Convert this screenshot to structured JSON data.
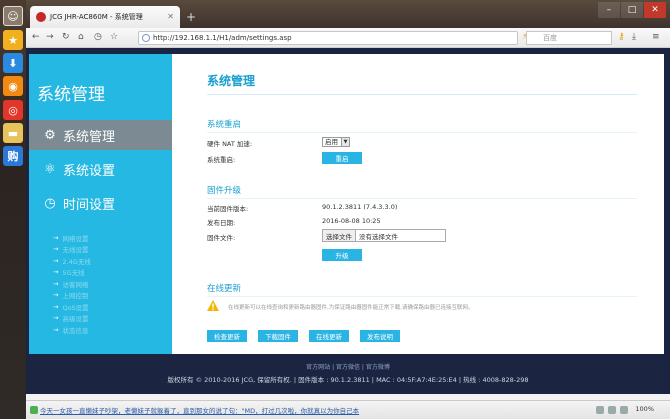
{
  "dock": {
    "icons": [
      "user-avatar",
      "star-icon",
      "download-icon",
      "rss-icon",
      "weibo-icon",
      "folder-icon",
      "shopping-icon"
    ],
    "shop_char": "购"
  },
  "browser": {
    "tab_title": "JCG JHR-AC860M - 系统管理",
    "url": "http://192.168.1.1/H1/adm/settings.asp",
    "search_placeholder": "百度"
  },
  "sidebar": {
    "brand": "系统管理",
    "items": [
      {
        "label": "系统管理",
        "icon": "gear-icon",
        "active": true
      },
      {
        "label": "系统设置",
        "icon": "settings-nodes-icon",
        "active": false
      },
      {
        "label": "时间设置",
        "icon": "clock-icon",
        "active": false
      }
    ],
    "sub_items": [
      "网络设置",
      "无线设置",
      "2.4G无线",
      "5G无线",
      "访客网络",
      "上网控制",
      "QoS设置",
      "高级设置",
      "状态信息"
    ]
  },
  "content": {
    "title": "系统管理",
    "restart": {
      "heading": "系统重启",
      "nat_label": "硬件 NAT 加速:",
      "nat_value": "启用",
      "reboot_label": "系统重启:",
      "reboot_button": "重启"
    },
    "upgrade": {
      "heading": "固件升级",
      "current_label": "当前固件版本:",
      "current_value": "90.1.2.3811 (7.4.3.3.0)",
      "date_label": "发布日期:",
      "date_value": "2016-08-08 10:25",
      "file_label": "固件文件:",
      "file_button": "选择文件",
      "file_value": "没有选择文件",
      "upgrade_button": "升级"
    },
    "online": {
      "heading": "在线更新",
      "note": "在线更新可以在线查询和更新路由器固件,为保证路由器固件能正常下载,请确保路由器已连接互联网。",
      "buttons": [
        "检查更新",
        "下载固件",
        "在线更新",
        "发布说明"
      ]
    }
  },
  "footer": {
    "links": "官方网站 | 官方微信 | 官方微博",
    "info": "版权所有 © 2010-2016 JCG, 保留所有权. | 固件版本 : 90.1.2.3811 | MAC : 04:5F:A7:4E:25:E4 | 热线 : 4008-828-298"
  },
  "statusbar": {
    "news": "今天一女孩一直懒妹子吵架，老懒妹子就躲着了，直到那女的说了句：\"MD，打过几次啦，你就真以为你自己本",
    "zoom": "100%"
  }
}
